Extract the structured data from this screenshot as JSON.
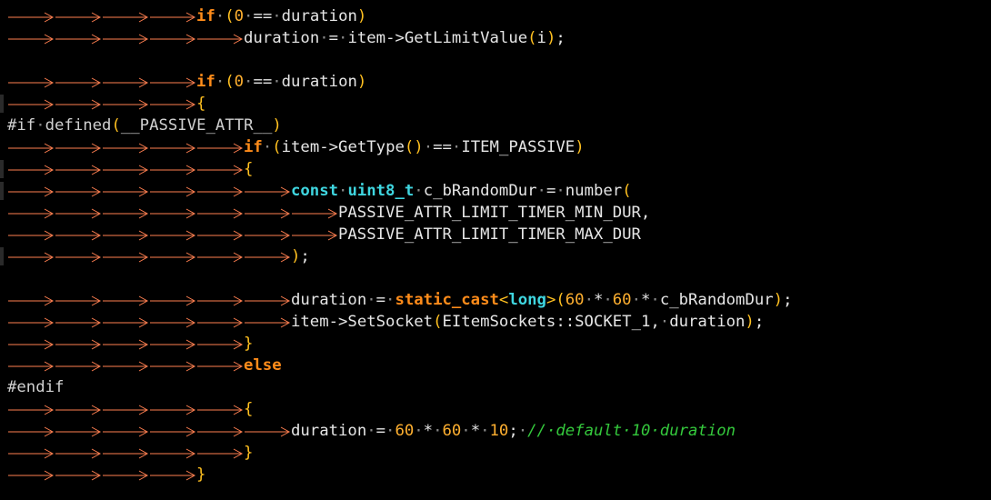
{
  "colors": {
    "background": "#000000",
    "default_text": "#e6e6e6",
    "keyword": "#ff8c1a",
    "type": "#3fd6e0",
    "number": "#ffb030",
    "bracket": "#ffc020",
    "comment": "#34c83c",
    "tab_arrow": "#ff7f50"
  },
  "icons": {
    "tab": "tab-arrow-icon",
    "fold": "fold-marker-icon"
  },
  "lines": [
    {
      "tabs": 4,
      "tokens": [
        [
          "kw",
          "if"
        ],
        [
          "dot",
          "·"
        ],
        [
          "br",
          "("
        ],
        [
          "num",
          "0"
        ],
        [
          "dot",
          "·"
        ],
        [
          "op",
          "=="
        ],
        [
          "dot",
          "·"
        ],
        [
          "op",
          "duration"
        ],
        [
          "br",
          ")"
        ]
      ]
    },
    {
      "tabs": 5,
      "tokens": [
        [
          "op",
          "duration"
        ],
        [
          "dot",
          "·"
        ],
        [
          "op",
          "="
        ],
        [
          "dot",
          "·"
        ],
        [
          "op",
          "item->GetLimitValue"
        ],
        [
          "br",
          "("
        ],
        [
          "op",
          "i"
        ],
        [
          "br",
          ")"
        ],
        [
          "op",
          ";"
        ]
      ]
    },
    {
      "tabs": 0,
      "tokens": []
    },
    {
      "tabs": 4,
      "tokens": [
        [
          "kw",
          "if"
        ],
        [
          "dot",
          "·"
        ],
        [
          "br",
          "("
        ],
        [
          "num",
          "0"
        ],
        [
          "dot",
          "·"
        ],
        [
          "op",
          "=="
        ],
        [
          "dot",
          "·"
        ],
        [
          "op",
          "duration"
        ],
        [
          "br",
          ")"
        ]
      ]
    },
    {
      "tabs": 4,
      "fold": true,
      "tokens": [
        [
          "br",
          "{"
        ]
      ]
    },
    {
      "tabs": 0,
      "tokens": [
        [
          "pre",
          "#if"
        ],
        [
          "dot",
          "·"
        ],
        [
          "pre",
          "defined"
        ],
        [
          "br",
          "("
        ],
        [
          "pre",
          "__PASSIVE_ATTR__"
        ],
        [
          "br",
          ")"
        ]
      ]
    },
    {
      "tabs": 5,
      "tokens": [
        [
          "kw",
          "if"
        ],
        [
          "dot",
          "·"
        ],
        [
          "br",
          "("
        ],
        [
          "op",
          "item->GetType"
        ],
        [
          "br",
          "()"
        ],
        [
          "dot",
          "·"
        ],
        [
          "op",
          "=="
        ],
        [
          "dot",
          "·"
        ],
        [
          "op",
          "ITEM_PASSIVE"
        ],
        [
          "br",
          ")"
        ]
      ]
    },
    {
      "tabs": 5,
      "fold": true,
      "tokens": [
        [
          "br",
          "{"
        ]
      ]
    },
    {
      "tabs": 6,
      "fold": true,
      "tokens": [
        [
          "type",
          "const"
        ],
        [
          "dot",
          "·"
        ],
        [
          "type",
          "uint8_t"
        ],
        [
          "dot",
          "·"
        ],
        [
          "op",
          "c_bRandomDur"
        ],
        [
          "dot",
          "·"
        ],
        [
          "op",
          "="
        ],
        [
          "dot",
          "·"
        ],
        [
          "op",
          "number"
        ],
        [
          "br",
          "("
        ]
      ]
    },
    {
      "tabs": 7,
      "tokens": [
        [
          "op",
          "PASSIVE_ATTR_LIMIT_TIMER_MIN_DUR,"
        ]
      ]
    },
    {
      "tabs": 7,
      "tokens": [
        [
          "op",
          "PASSIVE_ATTR_LIMIT_TIMER_MAX_DUR"
        ]
      ]
    },
    {
      "tabs": 6,
      "fold": true,
      "tokens": [
        [
          "br",
          ")"
        ],
        [
          "op",
          ";"
        ]
      ]
    },
    {
      "tabs": 0,
      "tokens": []
    },
    {
      "tabs": 6,
      "tokens": [
        [
          "op",
          "duration"
        ],
        [
          "dot",
          "·"
        ],
        [
          "op",
          "="
        ],
        [
          "dot",
          "·"
        ],
        [
          "kw",
          "static_cast"
        ],
        [
          "br",
          "<"
        ],
        [
          "type",
          "long"
        ],
        [
          "br",
          ">("
        ],
        [
          "num",
          "60"
        ],
        [
          "dot",
          "·"
        ],
        [
          "op",
          "*"
        ],
        [
          "dot",
          "·"
        ],
        [
          "num",
          "60"
        ],
        [
          "dot",
          "·"
        ],
        [
          "op",
          "*"
        ],
        [
          "dot",
          "·"
        ],
        [
          "op",
          "c_bRandomDur"
        ],
        [
          "br",
          ")"
        ],
        [
          "op",
          ";"
        ]
      ]
    },
    {
      "tabs": 6,
      "tokens": [
        [
          "op",
          "item->SetSocket"
        ],
        [
          "br",
          "("
        ],
        [
          "op",
          "EItemSockets::SOCKET_1,"
        ],
        [
          "dot",
          "·"
        ],
        [
          "op",
          "duration"
        ],
        [
          "br",
          ")"
        ],
        [
          "op",
          ";"
        ]
      ]
    },
    {
      "tabs": 5,
      "tokens": [
        [
          "br",
          "}"
        ]
      ]
    },
    {
      "tabs": 5,
      "tokens": [
        [
          "kw",
          "else"
        ]
      ]
    },
    {
      "tabs": 0,
      "tokens": [
        [
          "pre",
          "#endif"
        ]
      ]
    },
    {
      "tabs": 5,
      "tokens": [
        [
          "br",
          "{"
        ]
      ]
    },
    {
      "tabs": 6,
      "tokens": [
        [
          "op",
          "duration"
        ],
        [
          "dot",
          "·"
        ],
        [
          "op",
          "="
        ],
        [
          "dot",
          "·"
        ],
        [
          "num",
          "60"
        ],
        [
          "dot",
          "·"
        ],
        [
          "op",
          "*"
        ],
        [
          "dot",
          "·"
        ],
        [
          "num",
          "60"
        ],
        [
          "dot",
          "·"
        ],
        [
          "op",
          "*"
        ],
        [
          "dot",
          "·"
        ],
        [
          "num",
          "10"
        ],
        [
          "op",
          ";"
        ],
        [
          "dot",
          "·"
        ],
        [
          "cm",
          "//·default·10·duration"
        ]
      ]
    },
    {
      "tabs": 5,
      "tokens": [
        [
          "br",
          "}"
        ]
      ]
    },
    {
      "tabs": 4,
      "tokens": [
        [
          "br",
          "}"
        ]
      ]
    }
  ]
}
